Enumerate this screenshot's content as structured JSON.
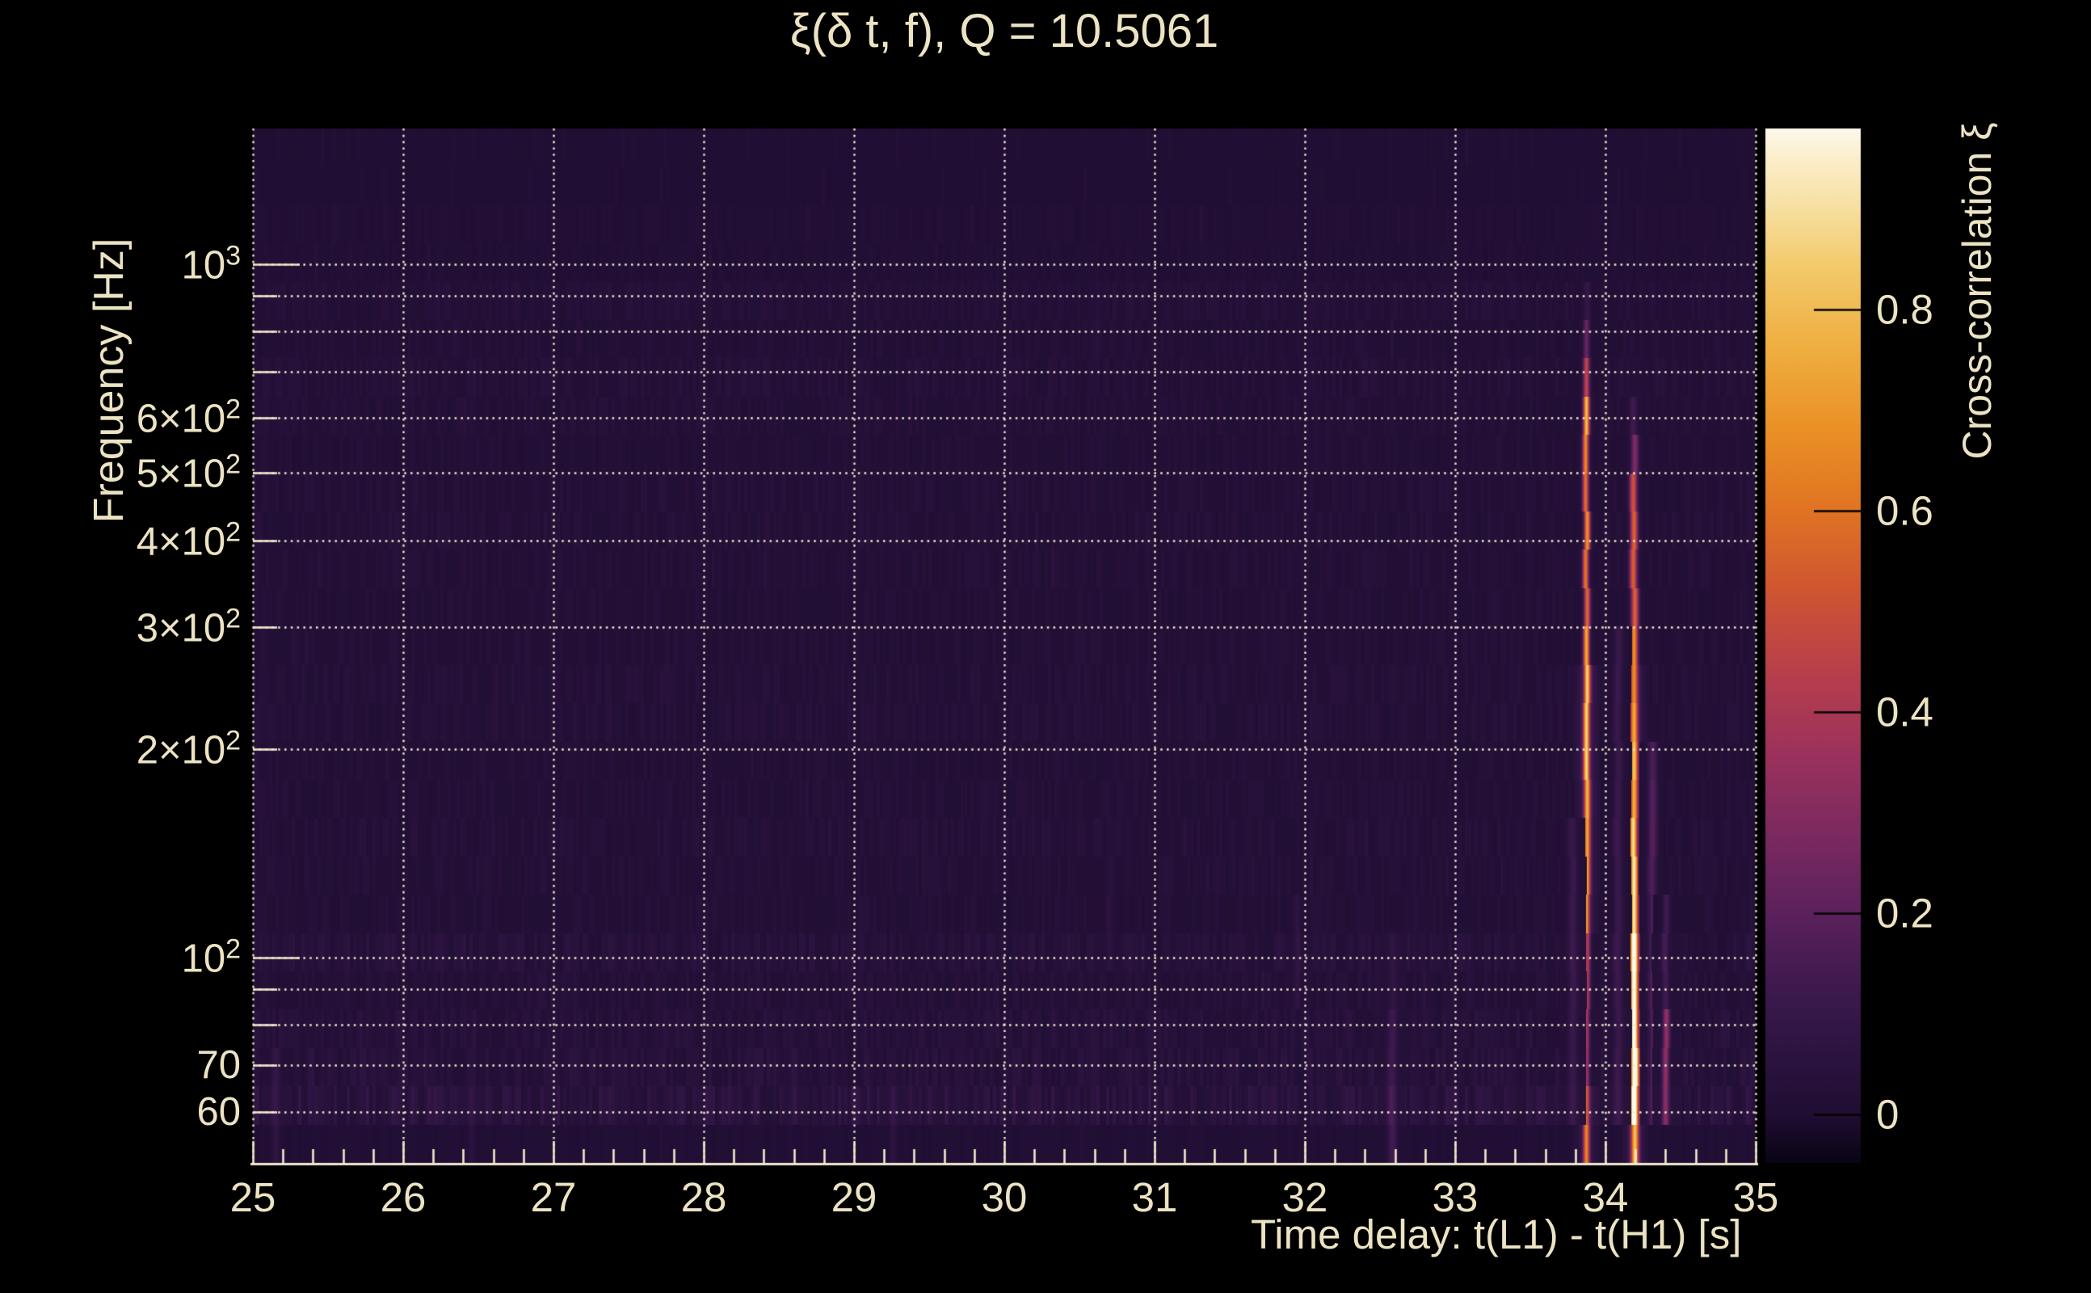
{
  "page": {
    "background": "#000000",
    "text_color": "#ece3c3",
    "grid_color": "#f0e8cc",
    "plot_bg": "#1e0e2f"
  },
  "chart_data": {
    "type": "heatmap",
    "title": "ξ(δ t, f), Q = 10.5061",
    "xlabel": "Time delay: t(L1) - t(H1) [s]",
    "ylabel": "Frequency [Hz]",
    "x_range": [
      25,
      35
    ],
    "x_ticks": [
      25,
      26,
      27,
      28,
      29,
      30,
      31,
      32,
      33,
      34,
      35
    ],
    "x_minor_tick_step": 0.2,
    "y_scale": "log",
    "y_range_hz": [
      50.6,
      1570
    ],
    "y_ticks": [
      {
        "base": "10",
        "exp": "3",
        "f": 1000
      },
      {
        "base": "6×10",
        "exp": "2",
        "f": 600
      },
      {
        "base": "5×10",
        "exp": "2",
        "f": 500
      },
      {
        "base": "4×10",
        "exp": "2",
        "f": 400
      },
      {
        "base": "3×10",
        "exp": "2",
        "f": 300
      },
      {
        "base": "2×10",
        "exp": "2",
        "f": 200
      },
      {
        "base": "10",
        "exp": "2",
        "f": 100
      },
      {
        "base": "70",
        "exp": "",
        "f": 70
      },
      {
        "base": "60",
        "exp": "",
        "f": 60
      }
    ],
    "y_gridlines_hz": [
      1000,
      900,
      800,
      700,
      600,
      500,
      400,
      300,
      200,
      100,
      90,
      80,
      70,
      60
    ],
    "x_gridlines": [
      25,
      26,
      27,
      28,
      29,
      30,
      31,
      32,
      33,
      34,
      35
    ],
    "grid_style": "dotted",
    "colorbar": {
      "label": "Cross-correlation ξ",
      "ticks": [
        {
          "label": "0.8",
          "value": 0.8
        },
        {
          "label": "0.6",
          "value": 0.6
        },
        {
          "label": "0.4",
          "value": 0.4
        },
        {
          "label": "0.2",
          "value": 0.2
        },
        {
          "label": "0",
          "value": 0.0
        }
      ],
      "vmin": -0.048,
      "vmax": 0.98,
      "colormap_stops": [
        [
          -0.048,
          "#0a0414"
        ],
        [
          0.0,
          "#200e33"
        ],
        [
          0.06,
          "#2c1440"
        ],
        [
          0.13,
          "#3f1a50"
        ],
        [
          0.2,
          "#5c215c"
        ],
        [
          0.28,
          "#7c2a60"
        ],
        [
          0.36,
          "#9c325c"
        ],
        [
          0.44,
          "#b83f4b"
        ],
        [
          0.52,
          "#cf5532"
        ],
        [
          0.6,
          "#e07323"
        ],
        [
          0.68,
          "#ea9025"
        ],
        [
          0.76,
          "#efae3f"
        ],
        [
          0.84,
          "#f3c969"
        ],
        [
          0.9,
          "#f7dfa0"
        ],
        [
          0.95,
          "#fbeecb"
        ],
        [
          0.98,
          "#fdf9ec"
        ]
      ]
    },
    "noise_bands": [
      {
        "f_min": 1250,
        "f_max": 1570,
        "base": 0.004
      },
      {
        "f_min": 1000,
        "f_max": 1250,
        "base": 0.012
      },
      {
        "f_min": 115,
        "f_max": 1000,
        "base": 0.018
      },
      {
        "f_min": 95,
        "f_max": 115,
        "base": 0.03
      },
      {
        "f_min": 65,
        "f_max": 95,
        "base": 0.026
      },
      {
        "f_min": 56,
        "f_max": 65,
        "base": 0.045
      },
      {
        "f_min": 50,
        "f_max": 56,
        "base": 0.007
      }
    ],
    "streaks": [
      {
        "name": "primary-streak",
        "t": 33.87,
        "sigma": 2.7,
        "segments": [
          [
            870,
            950,
            0.08
          ],
          [
            700,
            870,
            0.22
          ],
          [
            640,
            700,
            0.45
          ],
          [
            560,
            640,
            0.85
          ],
          [
            480,
            560,
            0.72
          ],
          [
            300,
            480,
            0.62
          ],
          [
            200,
            300,
            0.68
          ],
          [
            150,
            200,
            0.72
          ],
          [
            110,
            150,
            0.6
          ],
          [
            80,
            110,
            0.42
          ],
          [
            65,
            80,
            0.36
          ],
          [
            56,
            65,
            0.45
          ],
          [
            50,
            56,
            0.52
          ]
        ]
      },
      {
        "name": "secondary-streak",
        "t": 34.19,
        "sigma": 3.3,
        "segments": [
          [
            600,
            660,
            0.12
          ],
          [
            520,
            600,
            0.3
          ],
          [
            420,
            520,
            0.5
          ],
          [
            300,
            420,
            0.58
          ],
          [
            200,
            300,
            0.62
          ],
          [
            140,
            200,
            0.7
          ],
          [
            105,
            140,
            0.82
          ],
          [
            60,
            105,
            0.95
          ],
          [
            50,
            60,
            0.68
          ]
        ]
      },
      {
        "name": "side-column",
        "t": 34.08,
        "sigma": 4.0,
        "segments": [
          [
            60,
            300,
            0.1
          ]
        ]
      },
      {
        "name": "side-column",
        "t": 34.31,
        "sigma": 4.0,
        "segments": [
          [
            60,
            200,
            0.16
          ]
        ]
      },
      {
        "name": "side-column",
        "t": 34.4,
        "sigma": 3.0,
        "segments": [
          [
            80,
            130,
            0.12
          ],
          [
            55,
            80,
            0.3
          ]
        ]
      },
      {
        "name": "side-column",
        "t": 33.78,
        "sigma": 4.0,
        "segments": [
          [
            55,
            150,
            0.09
          ]
        ]
      },
      {
        "name": "faint-streak",
        "t": 32.58,
        "sigma": 4.0,
        "segments": [
          [
            80,
            110,
            0.05
          ],
          [
            62,
            80,
            0.1
          ],
          [
            50,
            62,
            0.14
          ]
        ]
      },
      {
        "name": "faint-streak",
        "t": 31.95,
        "sigma": 3.0,
        "segments": [
          [
            85,
            130,
            0.055
          ]
        ]
      },
      {
        "name": "faint-streak",
        "t": 25.15,
        "sigma": 3.5,
        "segments": [
          [
            50,
            75,
            0.07
          ]
        ]
      },
      {
        "name": "faint-streak",
        "t": 29.25,
        "sigma": 3.0,
        "segments": [
          [
            52,
            68,
            0.06
          ]
        ]
      },
      {
        "name": "faint-streak",
        "t": 26.45,
        "sigma": 3.0,
        "segments": [
          [
            52,
            62,
            0.05
          ]
        ]
      },
      {
        "name": "faint-streak",
        "t": 28.6,
        "sigma": 3.0,
        "segments": [
          [
            55,
            70,
            0.05
          ]
        ]
      },
      {
        "name": "faint-streak",
        "t": 30.7,
        "sigma": 3.0,
        "segments": [
          [
            90,
            140,
            0.04
          ]
        ]
      }
    ]
  }
}
